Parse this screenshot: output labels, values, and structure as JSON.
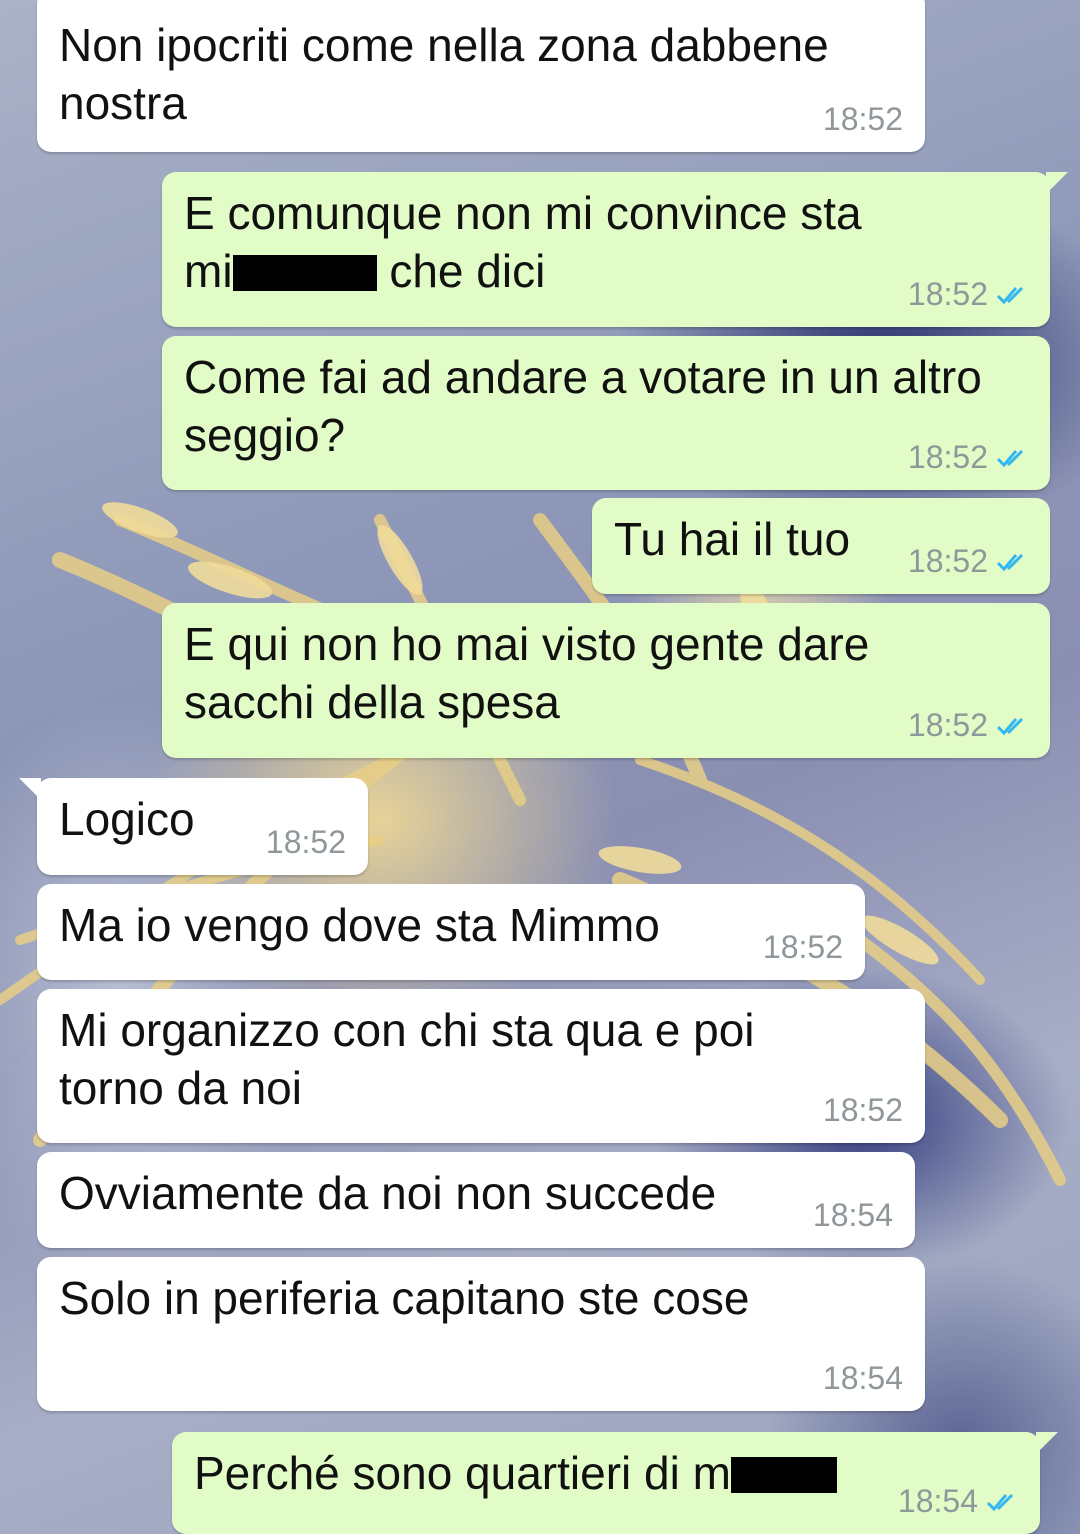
{
  "colors": {
    "incoming_bubble": "#ffffff",
    "outgoing_bubble": "#e1fcc6",
    "time_text": "#8f979b",
    "read_ticks": "#34b7f1"
  },
  "messages": [
    {
      "direction": "incoming",
      "text_line1": "Non ipocriti come nella zona dabbene",
      "text_line2": "nostra",
      "time": "18:52"
    },
    {
      "direction": "outgoing",
      "text_line1": "E comunque non mi convince sta",
      "text_pre": "mi",
      "text_post": "che dici",
      "redacted": true,
      "time": "18:52",
      "status": "read-ticks-icon"
    },
    {
      "direction": "outgoing",
      "text_line1": "Come fai ad andare a votare in un altro",
      "text_line2": "seggio?",
      "time": "18:52",
      "status": "read-ticks-icon"
    },
    {
      "direction": "outgoing",
      "text": "Tu hai il tuo",
      "time": "18:52",
      "status": "read-ticks-icon"
    },
    {
      "direction": "outgoing",
      "text_line1": "E qui non ho mai visto gente dare",
      "text_line2": "sacchi della spesa",
      "time": "18:52",
      "status": "read-ticks-icon"
    },
    {
      "direction": "incoming",
      "text": "Logico",
      "time": "18:52"
    },
    {
      "direction": "incoming",
      "text": "Ma io vengo dove sta Mimmo",
      "time": "18:52"
    },
    {
      "direction": "incoming",
      "text_line1": "Mi organizzo con chi sta qua e poi",
      "text_line2": "torno da noi",
      "time": "18:52"
    },
    {
      "direction": "incoming",
      "text": "Ovviamente da noi non succede",
      "time": "18:54"
    },
    {
      "direction": "incoming",
      "text": "Solo in periferia capitano ste cose",
      "time": "18:54"
    },
    {
      "direction": "outgoing",
      "text_pre": "Perché sono quartieri di m",
      "redacted": true,
      "time": "18:54",
      "status": "read-ticks-icon"
    }
  ]
}
